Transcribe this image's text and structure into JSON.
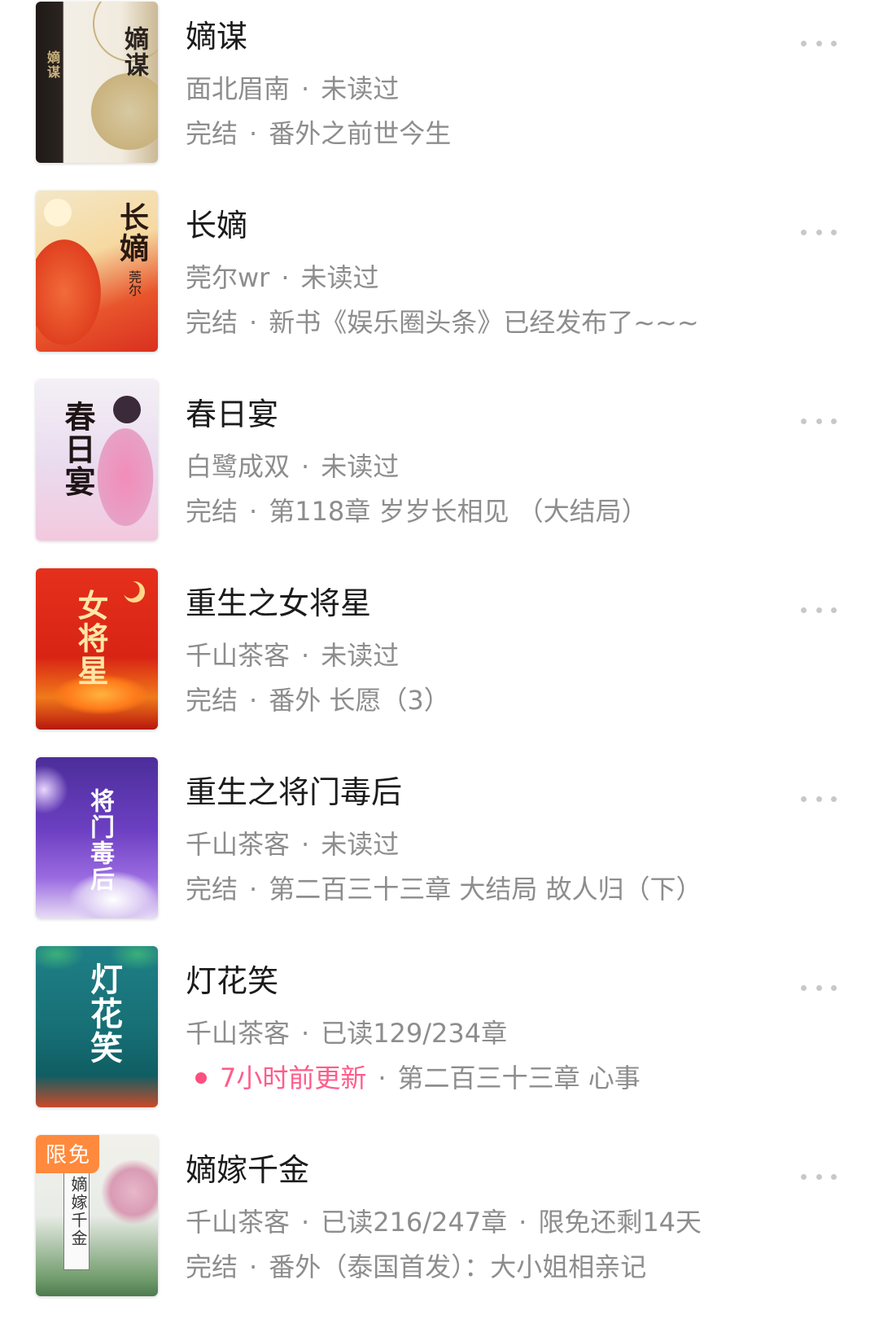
{
  "books": [
    {
      "title": "嫡谋",
      "author": "面北眉南",
      "progress": "未读过",
      "status": "完结",
      "latest": "番外之前世今生",
      "cover_text": "嫡谋"
    },
    {
      "title": "长嫡",
      "author": "莞尔wr",
      "progress": "未读过",
      "status": "完结",
      "latest": "新书《娱乐圈头条》已经发布了~~~",
      "cover_text": "长嫡",
      "cover_author": "莞尔"
    },
    {
      "title": "春日宴",
      "author": "白鹭成双",
      "progress": "未读过",
      "status": "完结",
      "latest": "第118章 岁岁长相见 （大结局）",
      "cover_text": "春日宴"
    },
    {
      "title": "重生之女将星",
      "author": "千山茶客",
      "progress": "未读过",
      "status": "完结",
      "latest": "番外 长愿（3）",
      "cover_text": "女将星"
    },
    {
      "title": "重生之将门毒后",
      "author": "千山茶客",
      "progress": "未读过",
      "status": "完结",
      "latest": "第二百三十三章 大结局 故人归（下）",
      "cover_text": "将门毒后"
    },
    {
      "title": "灯花笑",
      "author": "千山茶客",
      "progress": "已读129/234章",
      "update": "7小时前更新",
      "latest": "第二百三十三章 心事",
      "cover_text": "灯花笑"
    },
    {
      "title": "嫡嫁千金",
      "author": "千山茶客",
      "progress": "已读216/247章",
      "extra": "限免还剩14天",
      "status": "完结",
      "latest": "番外（泰国首发）：大小姐相亲记",
      "badge": "限免",
      "cover_text": "嫡嫁千金"
    }
  ],
  "sep": "·",
  "colors": {
    "title": "#1b1b1b",
    "meta": "#8d8d8d",
    "update": "#ff5c8a",
    "badge": "#ff8a3d"
  },
  "icons": [
    "more-icon"
  ]
}
